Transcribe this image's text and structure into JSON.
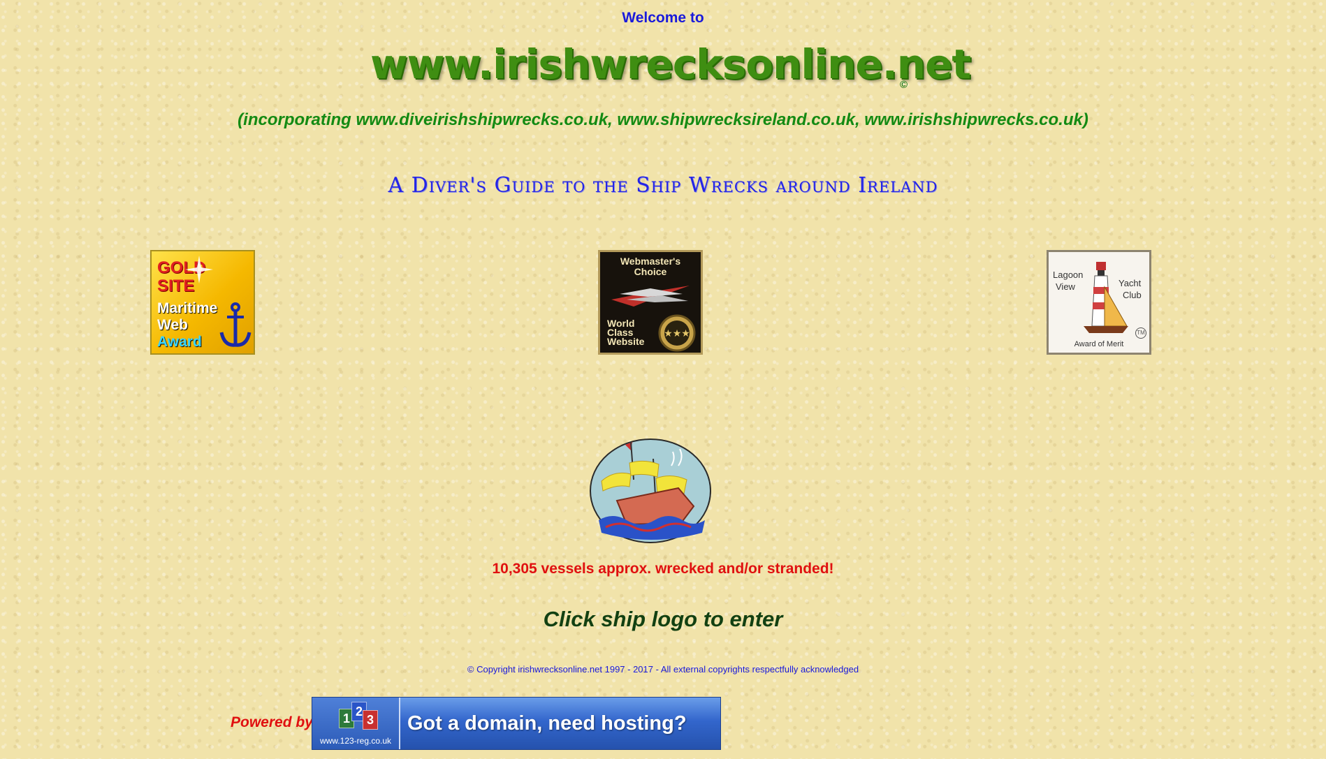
{
  "header": {
    "welcome": "Welcome to",
    "site_name": "www.irishwrecksonline.net",
    "copyright_mark": "©",
    "incorporating": "(incorporating www.diveirishshipwrecks.co.uk, www.shipwrecksireland.co.uk, www.irishshipwrecks.co.uk)",
    "guide_title": "A Diver's Guide to the Ship Wrecks around Ireland"
  },
  "awards": {
    "gold": {
      "lines": [
        "GOLD",
        "SITE",
        "Maritime",
        "Web",
        "Award"
      ]
    },
    "webmaster": {
      "top": [
        "Webmaster's",
        "Choice"
      ],
      "bottom": [
        "World",
        "Class",
        "Website"
      ]
    },
    "lagoon": {
      "left": [
        "Lagoon",
        "View"
      ],
      "right": [
        "Yacht",
        "Club"
      ],
      "bottom": "Award of Merit",
      "tm": "TM"
    }
  },
  "main": {
    "vessels_count": "10,305 vessels approx. wrecked and/or stranded!",
    "enter_text": "Click ship logo to enter",
    "copyright_line": "© Copyright irishwrecksonline.net 1997 - 2017 - All external copyrights respectfully acknowledged"
  },
  "footer": {
    "powered_by": "Powered by",
    "banner_digits": [
      "1",
      "2",
      "3"
    ],
    "banner_url": "www.123-reg.co.uk",
    "banner_text": "Got a domain, need hosting?"
  },
  "colors": {
    "background": "#f1e3aa",
    "blue_text": "#1a1adb",
    "green_text": "#138a13",
    "red_text": "#e01010",
    "dark_green_text": "#124012"
  }
}
